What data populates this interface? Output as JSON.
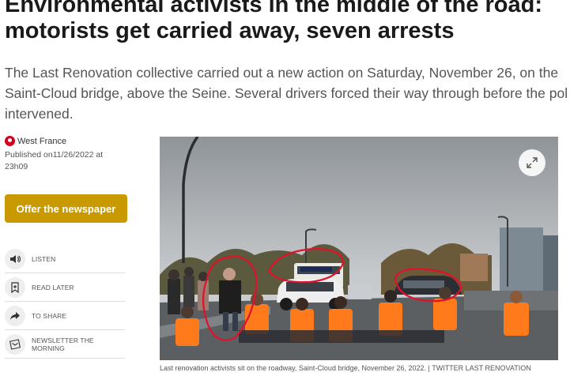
{
  "article": {
    "headline_line1": "Environmental activists in the middle of the road:",
    "headline_line2": "motorists get carried away, seven arrests",
    "lede_line1": "The Last Renovation collective carried out a new action on Saturday, November 26, on the",
    "lede_line2": "Saint-Cloud bridge, above the Seine. Several drivers forced their way through before the pol",
    "lede_line3": "intervened."
  },
  "source": {
    "name": "West France",
    "published_label": "Published on",
    "published_value": "11/26/2022 at 23h09",
    "logo_icon": "west-france-logo-icon",
    "logo_color": "#d6001c"
  },
  "offer_button": {
    "label": "Offer the newspaper",
    "color": "#c99a00"
  },
  "actions": [
    {
      "label": "LISTEN",
      "icon": "speaker-icon"
    },
    {
      "label": "READ LATER",
      "icon": "bookmark-plus-icon"
    },
    {
      "label": "TO SHARE",
      "icon": "share-arrow-icon"
    },
    {
      "label": "NEWSLETTER THE MORNING",
      "icon": "newsletter-icon"
    }
  ],
  "photo": {
    "expand_icon": "expand-icon",
    "caption": "Last renovation activists sit on the roadway, Saint-Cloud bridge, November 26, 2022. | TWITTER LAST RENOVATION",
    "vest_color": "#ff7a1a",
    "annotation_color": "#e0112a"
  }
}
